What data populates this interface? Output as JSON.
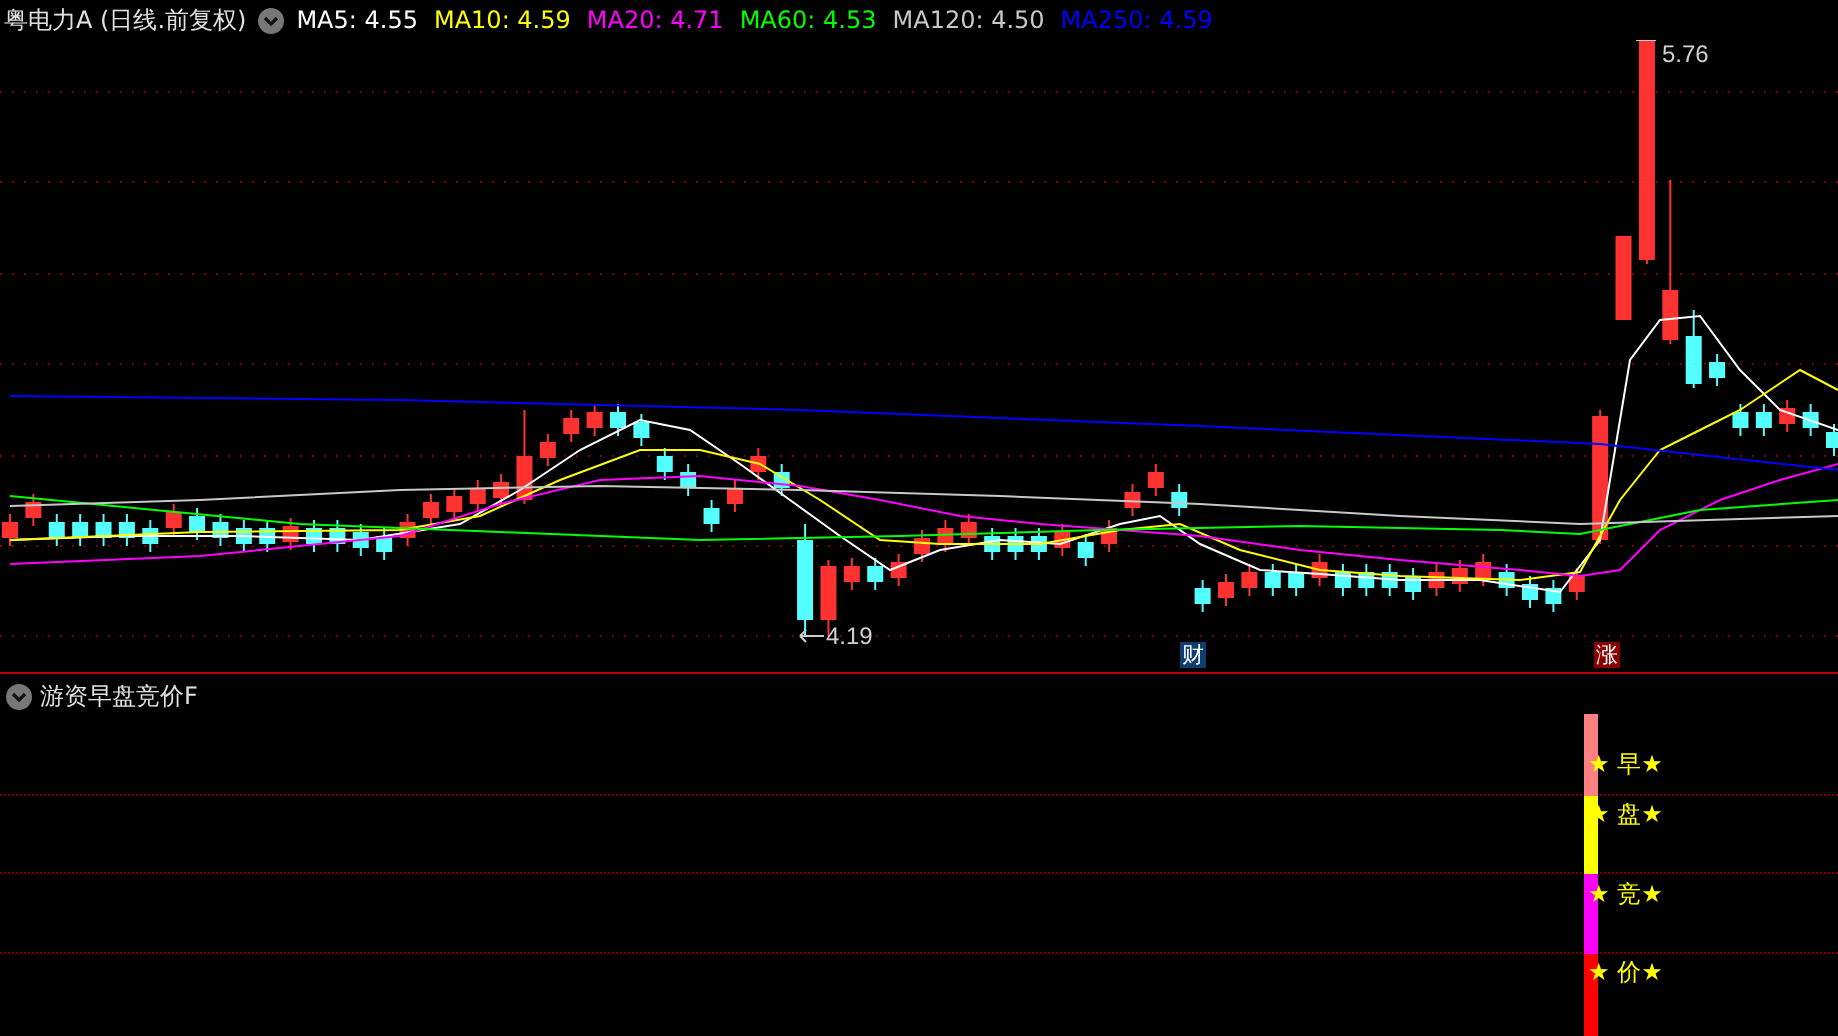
{
  "header": {
    "title": "粤电力A (日线.前复权)",
    "moving_averages": [
      {
        "label": "MA5: 4.55",
        "color": "#ffffff"
      },
      {
        "label": "MA10: 4.59",
        "color": "#ffff00"
      },
      {
        "label": "MA20: 4.71",
        "color": "#ff00ff"
      },
      {
        "label": "MA60: 4.53",
        "color": "#00ff00"
      },
      {
        "label": "MA120: 4.50",
        "color": "#c8c8c8"
      },
      {
        "label": "MA250: 4.59",
        "color": "#0000ff"
      }
    ]
  },
  "price_chart": {
    "high_label": "5.76",
    "low_label": "4.19",
    "markers": [
      {
        "text": "财",
        "color": "#0f3d6e"
      },
      {
        "text": "涨",
        "color": "#8b0000"
      }
    ]
  },
  "indicator": {
    "title": "游资早盘竞价F",
    "signals": [
      {
        "text": "★ 早★",
        "color": "#ff8080"
      },
      {
        "text": "★ 盘★",
        "color": "#ffff00"
      },
      {
        "text": "★ 竞★",
        "color": "#ff00ff"
      },
      {
        "text": "★ 价★",
        "color": "#ff0000"
      }
    ]
  }
}
